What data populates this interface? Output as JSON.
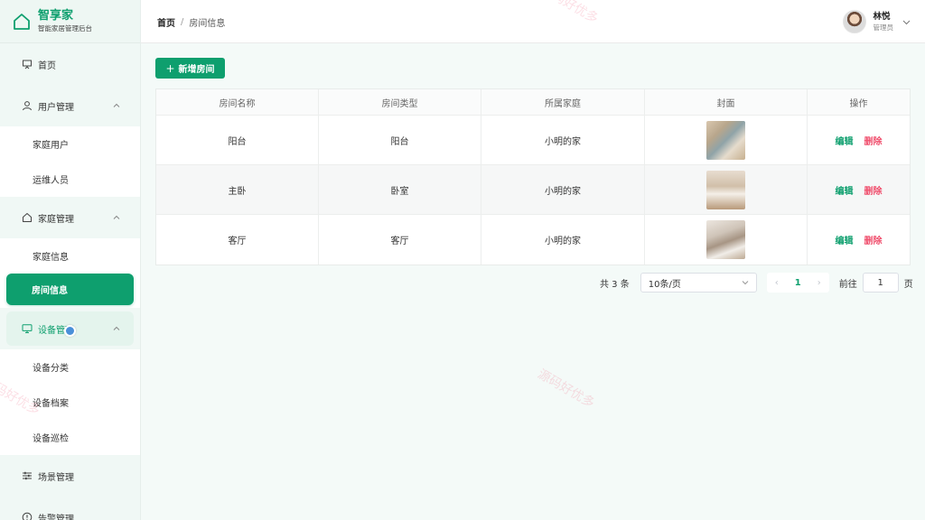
{
  "brand": {
    "title": "智享家",
    "subtitle": "智能家居管理后台"
  },
  "sidebar": {
    "home": "首页",
    "user_mgmt": {
      "label": "用户管理",
      "items": [
        "家庭用户",
        "运维人员"
      ]
    },
    "family_mgmt": {
      "label": "家庭管理",
      "items": [
        "家庭信息",
        "房间信息"
      ]
    },
    "device_mgmt": {
      "label": "设备管理",
      "items": [
        "设备分类",
        "设备档案",
        "设备巡检"
      ]
    },
    "scene_mgmt": "场景管理",
    "alarm_mgmt": "告警管理"
  },
  "header": {
    "breadcrumb_home": "首页",
    "breadcrumb_sep": "/",
    "breadcrumb_current": "房间信息",
    "user_name": "林悦",
    "user_role": "管理员"
  },
  "toolbar": {
    "add_label": "新增房间"
  },
  "table": {
    "columns": [
      "房间名称",
      "房间类型",
      "所属家庭",
      "封面",
      "操作"
    ],
    "rows": [
      {
        "name": "阳台",
        "type": "阳台",
        "family": "小明的家",
        "cover": "balcony-photo"
      },
      {
        "name": "主卧",
        "type": "卧室",
        "family": "小明的家",
        "cover": "bedroom-photo"
      },
      {
        "name": "客厅",
        "type": "客厅",
        "family": "小明的家",
        "cover": "living-room-photo"
      }
    ],
    "edit_label": "编辑",
    "delete_label": "删除"
  },
  "pagination": {
    "total_text": "共 3 条",
    "page_size": "10条/页",
    "current_page": "1",
    "goto_label": "前往",
    "goto_value": "1",
    "page_suffix": "页"
  },
  "watermark": "源码好优多",
  "colors": {
    "accent": "#0e9f6e",
    "danger": "#f0506e"
  }
}
